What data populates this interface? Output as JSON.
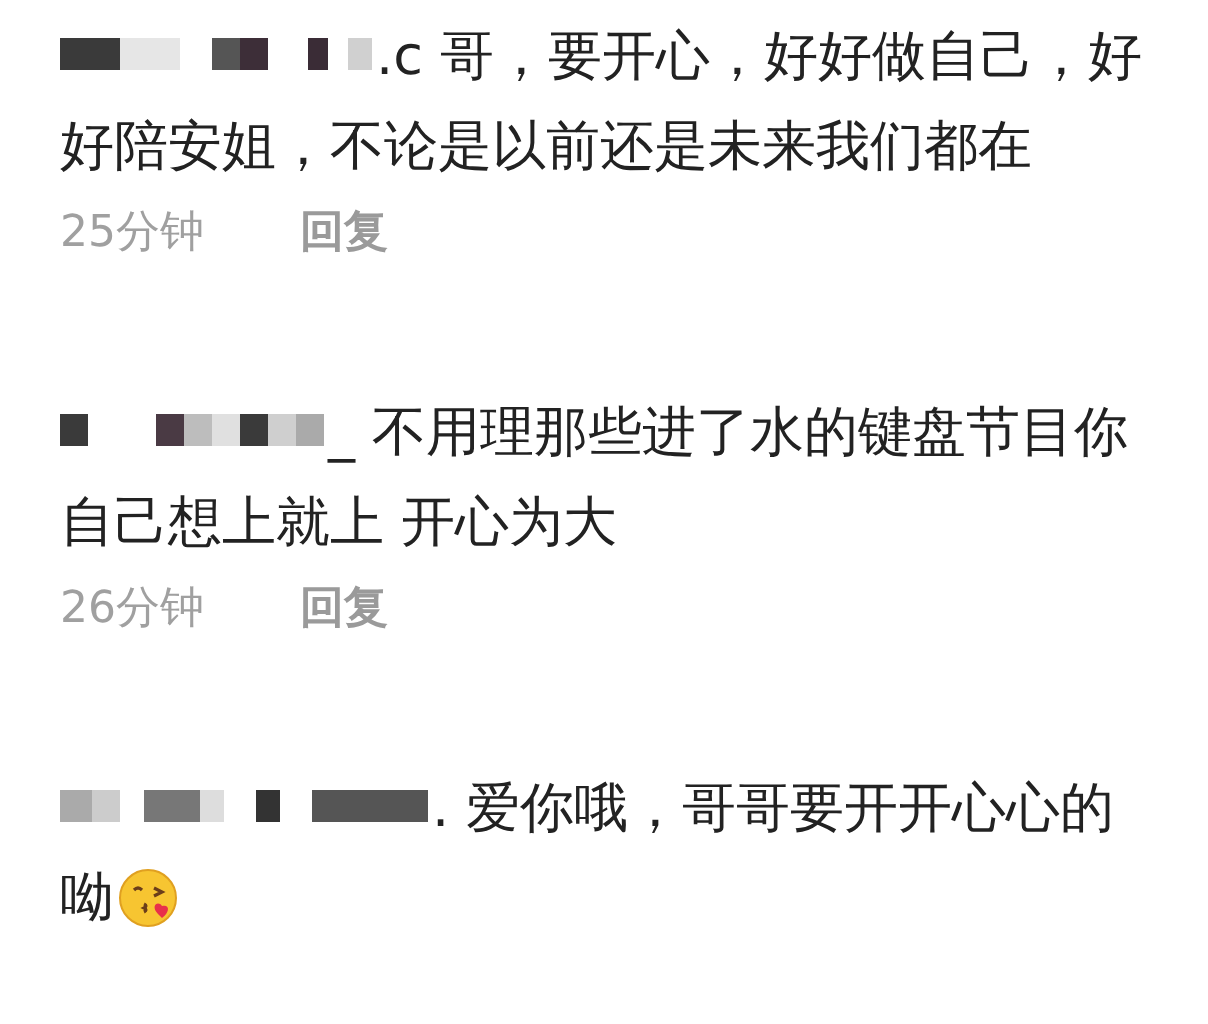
{
  "comments": [
    {
      "author_redacted": true,
      "text": ".c 哥，要开心，好好做自己，好好陪安姐，不论是以前还是未来我们都在",
      "time": "25分钟",
      "reply": "回复"
    },
    {
      "author_redacted": true,
      "text": "_ 不用理那些进了水的键盘节目你自己想上就上 开心为大",
      "time": "26分钟",
      "reply": "回复"
    },
    {
      "author_redacted": true,
      "text": ". 爱你哦，哥哥要开开心心的呦",
      "emoji": {
        "kind": "kiss"
      }
    }
  ]
}
